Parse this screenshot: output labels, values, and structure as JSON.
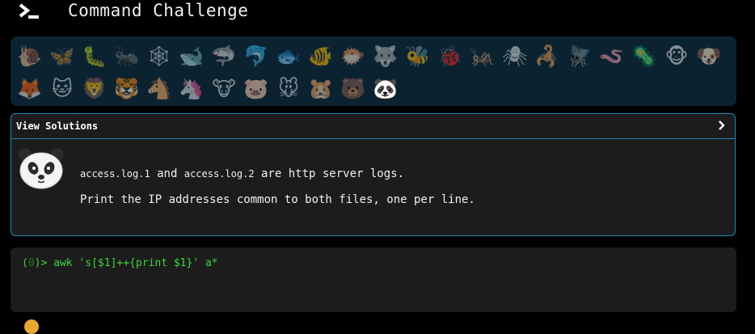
{
  "header": {
    "title": "Command Challenge",
    "logo_icon": "terminal-prompt-icon"
  },
  "animals": {
    "row1": [
      {
        "name": "snail",
        "glyph": "🐌"
      },
      {
        "name": "butterfly",
        "glyph": "🦋"
      },
      {
        "name": "caterpillar",
        "glyph": "🐛"
      },
      {
        "name": "ant",
        "glyph": "🐜"
      },
      {
        "name": "spider-web",
        "glyph": "🕸"
      },
      {
        "name": "whale",
        "glyph": "🐋"
      },
      {
        "name": "shark",
        "glyph": "🦈"
      },
      {
        "name": "dolphin",
        "glyph": "🐬"
      },
      {
        "name": "fish",
        "glyph": "🐟"
      },
      {
        "name": "tropical-fish",
        "glyph": "🐠"
      },
      {
        "name": "blowfish",
        "glyph": "🐡"
      },
      {
        "name": "wolf",
        "glyph": "🐺"
      },
      {
        "name": "bee",
        "glyph": "🐝"
      },
      {
        "name": "ladybug",
        "glyph": "🐞"
      },
      {
        "name": "cricket",
        "glyph": "🦗"
      },
      {
        "name": "spider",
        "glyph": "🕷"
      },
      {
        "name": "scorpion",
        "glyph": "🦂"
      },
      {
        "name": "fly",
        "glyph": "🪰"
      },
      {
        "name": "worm",
        "glyph": "🪱"
      },
      {
        "name": "microbe",
        "glyph": "🦠"
      },
      {
        "name": "monkey",
        "glyph": "🐵"
      },
      {
        "name": "dog",
        "glyph": "🐶"
      }
    ],
    "row2": [
      {
        "name": "fox",
        "glyph": "🦊"
      },
      {
        "name": "cat",
        "glyph": "🐱"
      },
      {
        "name": "lion",
        "glyph": "🦁"
      },
      {
        "name": "tiger",
        "glyph": "🐯"
      },
      {
        "name": "horse",
        "glyph": "🐴"
      },
      {
        "name": "unicorn",
        "glyph": "🦄"
      },
      {
        "name": "cow",
        "glyph": "🐮"
      },
      {
        "name": "pig",
        "glyph": "🐷"
      },
      {
        "name": "mouse",
        "glyph": "🐭"
      },
      {
        "name": "hamster",
        "glyph": "🐹"
      },
      {
        "name": "bear",
        "glyph": "🐻"
      },
      {
        "name": "panda",
        "glyph": "🐼"
      }
    ]
  },
  "panel": {
    "header_label": "View Solutions",
    "file1": "access.log.1",
    "and_text": " and ",
    "file2": "access.log.2",
    "rest_text": " are http server logs.",
    "line2": "Print the IP addresses common to both files, one per line.",
    "avatar_icon": "panda-icon"
  },
  "terminal": {
    "prompt_open": "(",
    "prompt_count": "0",
    "prompt_close": ")> ",
    "command": "awk 's[$1]++{print $1}' a*"
  }
}
